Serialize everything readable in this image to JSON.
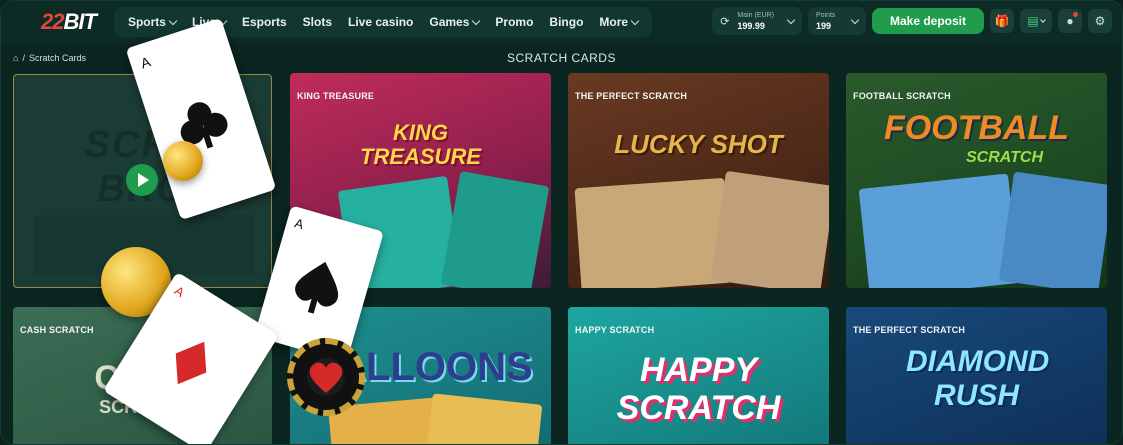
{
  "brand": {
    "num": "22",
    "text": "BIT"
  },
  "nav": [
    {
      "label": "Sports",
      "chevron": true
    },
    {
      "label": "Live",
      "chevron": true
    },
    {
      "label": "Esports",
      "chevron": false
    },
    {
      "label": "Slots",
      "chevron": false
    },
    {
      "label": "Live casino",
      "chevron": false
    },
    {
      "label": "Games",
      "chevron": true
    },
    {
      "label": "Promo",
      "chevron": false
    },
    {
      "label": "Bingo",
      "chevron": false
    },
    {
      "label": "More",
      "chevron": true
    }
  ],
  "wallet": {
    "main_label": "Main (EUR)",
    "main_value": "199.99",
    "points_label": "Points",
    "points_value": "199"
  },
  "deposit_label": "Make deposit",
  "breadcrumb": {
    "sep": "/",
    "current": "Scratch Cards"
  },
  "page_title": "SCRATCH CARDS",
  "tiles": [
    {
      "name": "",
      "art": "SCRA BRO"
    },
    {
      "name": "KING TREASURE",
      "art": "KING TREASURE"
    },
    {
      "name": "THE PERFECT SCRATCH",
      "art": "LUCKY SHOT"
    },
    {
      "name": "FOOTBALL SCRATCH",
      "art": "FOOTBALL"
    },
    {
      "name": "CASH SCRATCH",
      "art": "CASH"
    },
    {
      "name": "",
      "art": "BALLOONS"
    },
    {
      "name": "HAPPY SCRATCH",
      "art": "HAPPY SCRATCH"
    },
    {
      "name": "THE PERFECT SCRATCH",
      "art": "DIAMOND RUSH"
    }
  ],
  "art_extra": {
    "football_sub": "SCRATCH",
    "cash_sub": "SCRATCH",
    "happy_sub": "SCRATCH"
  },
  "colors": {
    "accent": "#1f9d4d",
    "brand_red": "#e0483c",
    "bg": "#0b2520"
  }
}
